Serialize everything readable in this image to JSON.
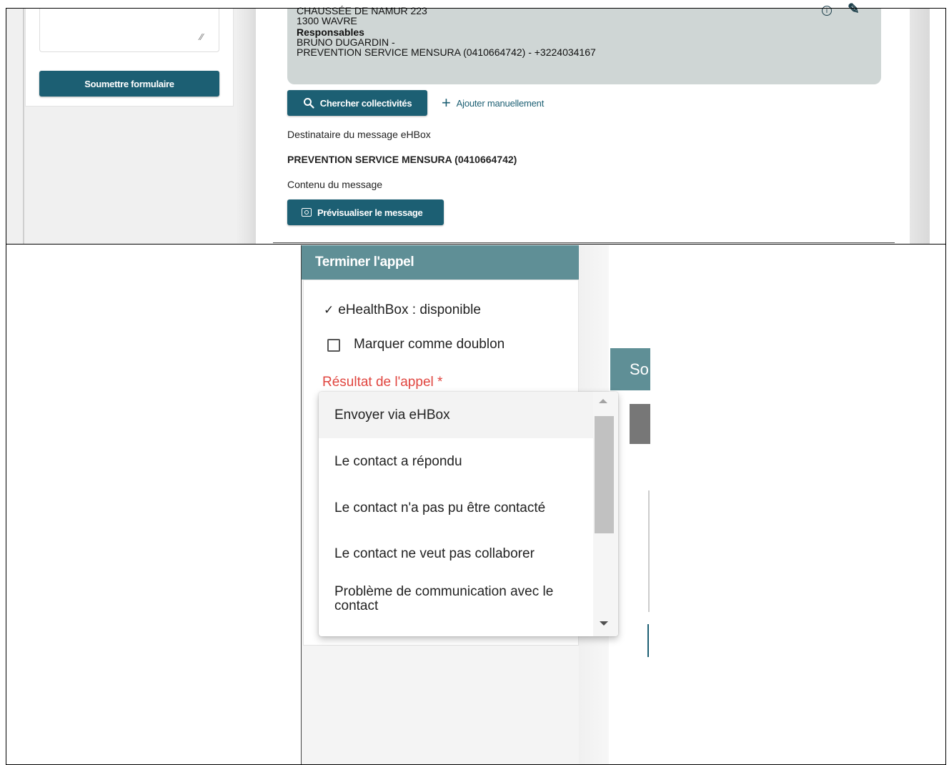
{
  "top": {
    "submit_label": "Soumettre formulaire",
    "address": {
      "street": "CHAUSSÉE DE NAMUR 223",
      "city": "1300 WAVRE",
      "responsables_title": "Responsables",
      "responsable_1": "BRUNO DUGARDIN -",
      "responsable_2": "PREVENTION SERVICE MENSURA (0410664742) - +3224034167"
    },
    "search_button": "Chercher collectivités",
    "add_manual": "Ajouter manuellement",
    "recipient_label": "Destinataire du message eHBox",
    "recipient_value": "PREVENTION SERVICE MENSURA (0410664742)",
    "content_label": "Contenu du message",
    "preview_button": "Prévisualiser le message"
  },
  "bottom": {
    "panel_title": "Terminer l'appel",
    "status": "eHealthBox : disponible",
    "duplicate_label": "Marquer comme doublon",
    "result_label": "Résultat de l'appel *",
    "side_tab": "So",
    "options": [
      "Envoyer via eHBox",
      "Le contact a répondu",
      "Le contact n'a pas pu être contacté",
      "Le contact ne veut pas collaborer",
      "Problème de communication avec le contact"
    ]
  },
  "icons": {
    "search": "search-icon",
    "plus": "plus-icon",
    "eye": "eye-icon",
    "info": "info-icon",
    "edit": "edit-icon",
    "check": "check-icon"
  },
  "colors": {
    "primary_button": "#1c5f73",
    "panel_header": "#5f8f96",
    "address_card": "#cfd6d5",
    "required_label": "#e0453f"
  }
}
